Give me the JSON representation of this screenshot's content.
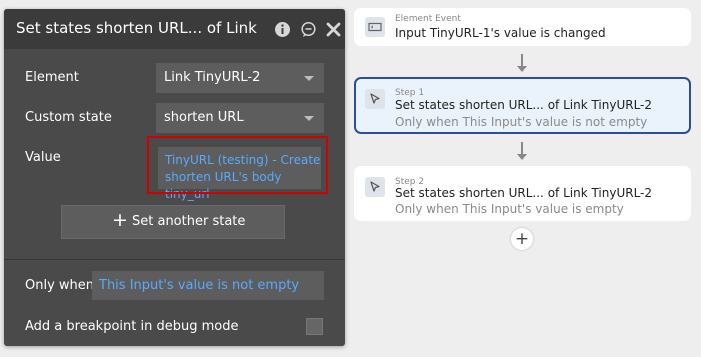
{
  "panel": {
    "title": "Set states shorten URL... of Link",
    "element_label": "Element",
    "element_value": "Link TinyURL-2",
    "custom_state_label": "Custom state",
    "custom_state_value": "shorten URL",
    "value_label": "Value",
    "value_expression": "TinyURL (testing) - Create shorten URL's body tiny_url",
    "set_another_state_label": "Set another state",
    "only_when_label": "Only when",
    "only_when_value": "This Input's value is not empty",
    "breakpoint_label": "Add a breakpoint in debug mode",
    "icons": [
      "info-icon",
      "comment-icon",
      "close-icon",
      "plus-icon",
      "chevron-down-icon"
    ]
  },
  "workflow": {
    "event": {
      "kicker": "Element Event",
      "title": "Input TinyURL-1's value is changed",
      "icon": "input-event-icon"
    },
    "steps": [
      {
        "kicker": "Step 1",
        "title": "Set states shorten URL... of Link TinyURL-2",
        "condition": "Only when This Input's value is not empty",
        "icon": "cursor-icon",
        "selected": true
      },
      {
        "kicker": "Step 2",
        "title": "Set states shorten URL... of Link TinyURL-2",
        "condition": "Only when This Input's value is empty",
        "icon": "cursor-icon",
        "selected": false
      }
    ],
    "add_step_symbol": "+"
  },
  "colors": {
    "panel_bg": "#4a4a4a",
    "panel_header_bg": "#3b3b3b",
    "field_bg": "#5d5d5d",
    "expression_blue": "#5aa9ff",
    "highlight_red": "#d40000",
    "selected_border": "#2c4f9c",
    "selected_bg": "#eaf2fc"
  }
}
